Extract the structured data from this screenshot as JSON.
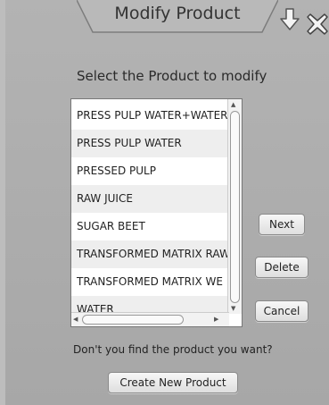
{
  "dialog": {
    "title": "Modify Product",
    "prompt": "Select the Product to modify",
    "question": "Don't you find the product you want?"
  },
  "icons": {
    "down": "down-arrow-icon",
    "close": "close-icon"
  },
  "products": [
    "PRESS PULP WATER+WATER",
    "PRESS PULP WATER",
    "PRESSED PULP",
    "RAW JUICE",
    "SUGAR BEET",
    "TRANSFORMED MATRIX RAW",
    "TRANSFORMED MATRIX WE",
    "WATER"
  ],
  "buttons": {
    "next": "Next",
    "delete": "Delete",
    "cancel": "Cancel",
    "create": "Create New Product"
  }
}
